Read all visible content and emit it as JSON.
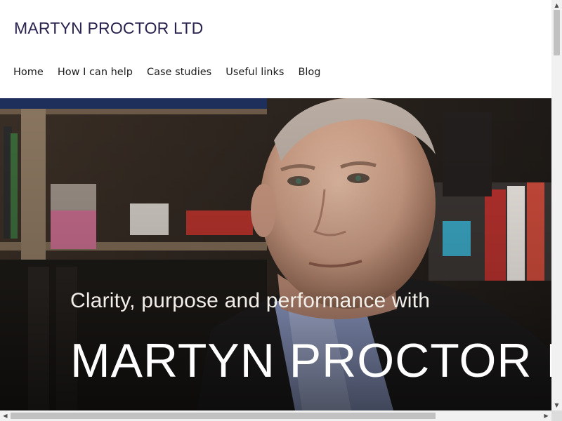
{
  "site": {
    "brand": "MARTYN PROCTOR LTD"
  },
  "nav": {
    "items": [
      {
        "label": "Home"
      },
      {
        "label": "How I can help"
      },
      {
        "label": "Case studies"
      },
      {
        "label": "Useful links"
      },
      {
        "label": "Blog"
      }
    ]
  },
  "hero": {
    "tagline": "Clarity, purpose and performance with",
    "title": "MARTYN PROCTOR LTD",
    "image_desc_icon": "portrait-photo"
  },
  "scrollbars": {
    "up_arrow": "▲",
    "down_arrow": "▼",
    "left_arrow": "◀",
    "right_arrow": "▶"
  },
  "colors": {
    "brand": "#2a2350",
    "nav_text": "#1d1d1d",
    "hero_text": "#ffffff"
  }
}
